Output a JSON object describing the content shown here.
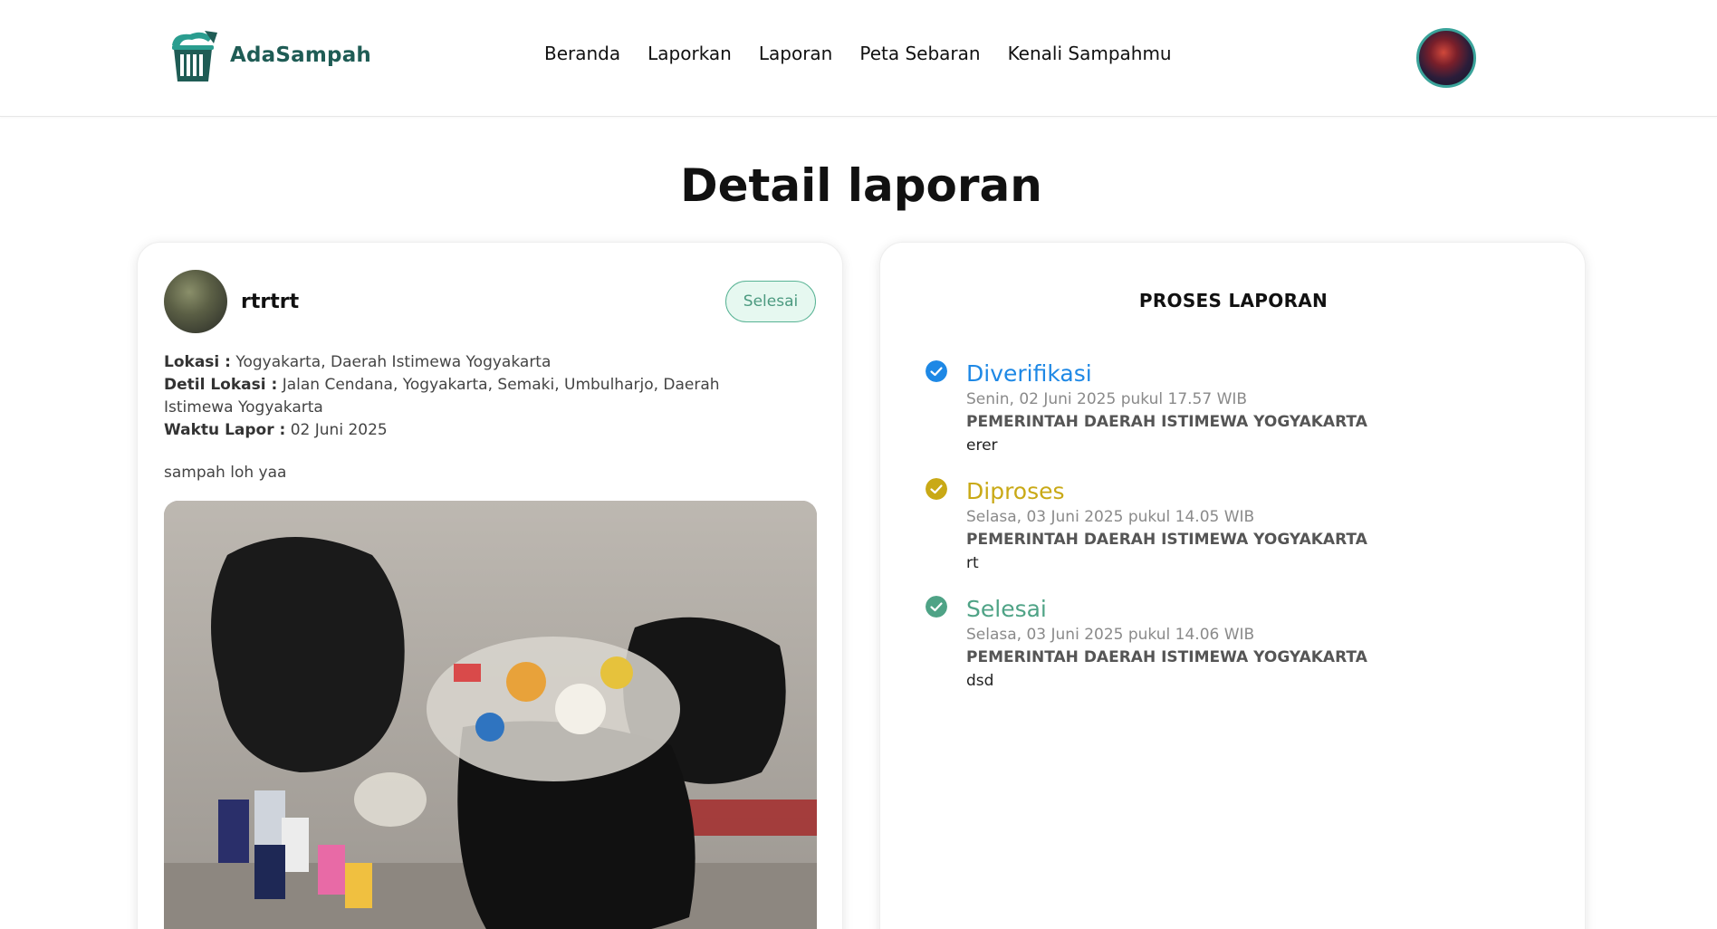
{
  "brand": {
    "name": "AdaSampah",
    "accent": "#1f5c55",
    "icon": "trash-logo-icon"
  },
  "nav": {
    "items": [
      "Beranda",
      "Laporkan",
      "Laporan",
      "Peta Sebaran",
      "Kenali Sampahmu"
    ]
  },
  "page": {
    "title": "Detail laporan"
  },
  "report": {
    "username": "rtrtrt",
    "status": "Selesai",
    "lokasi_label": "Lokasi :",
    "lokasi": "Yogyakarta, Daerah Istimewa Yogyakarta",
    "detil_label": "Detil Lokasi :",
    "detil": "Jalan Cendana, Yogyakarta, Semaki, Umbulharjo, Daerah Istimewa Yogyakarta",
    "waktu_label": "Waktu Lapor :",
    "waktu": "02 Juni 2025",
    "description": "sampah loh yaa"
  },
  "process": {
    "title": "PROSES LAPORAN",
    "steps": [
      {
        "title": "Diverifikasi",
        "date": "Senin, 02 Juni 2025 pukul 17.57 WIB",
        "org": "PEMERINTAH DAERAH ISTIMEWA YOGYAKARTA",
        "note": "erer",
        "color": "#1e88e5",
        "icon": "check-circle-icon"
      },
      {
        "title": "Diproses",
        "date": "Selasa, 03 Juni 2025 pukul 14.05 WIB",
        "org": "PEMERINTAH DAERAH ISTIMEWA YOGYAKARTA",
        "note": "rt",
        "color": "#c9a916",
        "icon": "check-circle-icon"
      },
      {
        "title": "Selesai",
        "date": "Selasa, 03 Juni 2025 pukul 14.06 WIB",
        "org": "PEMERINTAH DAERAH ISTIMEWA YOGYAKARTA",
        "note": "dsd",
        "color": "#4fa386",
        "icon": "check-circle-icon"
      }
    ]
  }
}
